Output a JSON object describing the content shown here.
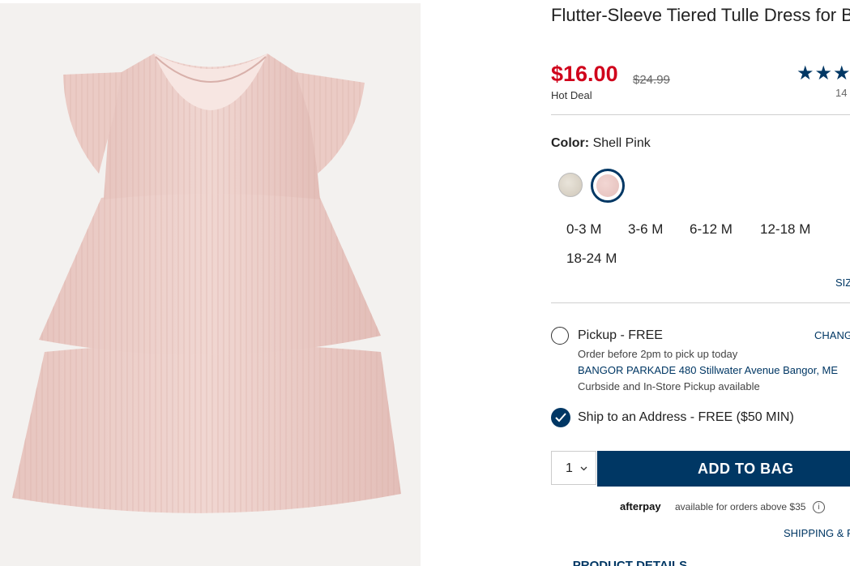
{
  "product": {
    "title": "Flutter-Sleeve Tiered Tulle Dress for Baby",
    "price": "$16.00",
    "original_price": "$24.99",
    "deal_label": "Hot Deal",
    "rating_stars": "★★★",
    "review_count": "14"
  },
  "color": {
    "label": "Color:",
    "selected": "Shell Pink",
    "swatches": [
      "oatmeal-swatch",
      "shell-pink-swatch"
    ]
  },
  "sizes": [
    "0-3 M",
    "3-6 M",
    "6-12 M",
    "12-18 M",
    "18-24 M"
  ],
  "size_chart_label": "SIZ",
  "fulfillment": {
    "pickup": {
      "label": "Pickup - FREE",
      "change_label": "CHANG",
      "cutoff": "Order before 2pm to pick up today",
      "store": "BANGOR PARKADE 480 Stillwater Avenue  Bangor, ME",
      "note": "Curbside and In-Store Pickup available"
    },
    "ship": {
      "label": "Ship to an Address - FREE ($50 MIN)"
    }
  },
  "cart": {
    "quantity": "1",
    "add_to_bag": "ADD TO BAG"
  },
  "afterpay": {
    "logo": "afterpay",
    "text": "available for orders above $35",
    "info_icon": "i"
  },
  "shipping_link": "SHIPPING & R",
  "product_details": "PRODUCT DETAILS",
  "colors": {
    "accent": "#003764",
    "sale": "#d0021b"
  }
}
